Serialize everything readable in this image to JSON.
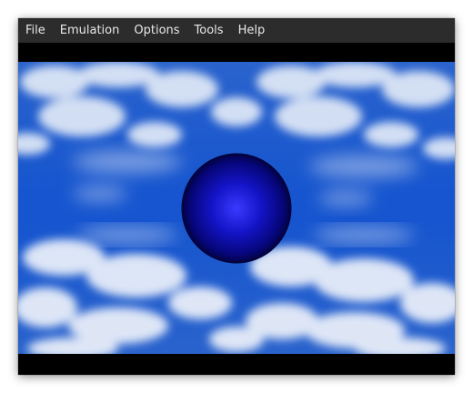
{
  "menubar": {
    "items": [
      {
        "label": "File"
      },
      {
        "label": "Emulation"
      },
      {
        "label": "Options"
      },
      {
        "label": "Tools"
      },
      {
        "label": "Help"
      }
    ]
  },
  "screen": {
    "sky_color": "#1a5ad0",
    "cloud_color": "#e8eef8",
    "sphere_color": "#1010b8"
  }
}
